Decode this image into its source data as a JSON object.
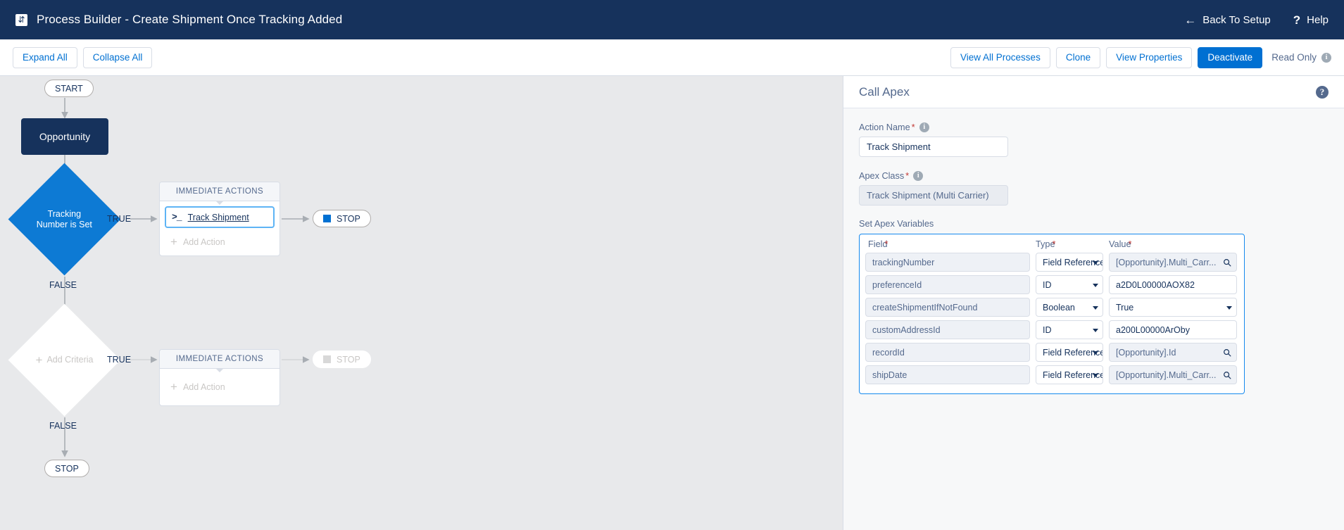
{
  "topbar": {
    "app_icon": "process-builder-icon",
    "title": "Process Builder - Create Shipment Once Tracking Added",
    "back_label": "Back To Setup",
    "help_label": "Help",
    "bg_color": "#16325c"
  },
  "toolbar": {
    "expand_all": "Expand All",
    "collapse_all": "Collapse All",
    "view_all_processes": "View All Processes",
    "clone": "Clone",
    "view_properties": "View Properties",
    "deactivate": "Deactivate",
    "read_only": "Read Only",
    "primary_color": "#0070d2"
  },
  "canvas": {
    "start_label": "START",
    "object_node": "Opportunity",
    "criteria_1": "Tracking\nNumber is Set",
    "criteria_1_line1": "Tracking",
    "criteria_1_line2": "Number is Set",
    "criteria_2": "Add Criteria",
    "true_label_1": "TRUE",
    "false_label_1": "FALSE",
    "true_label_2": "TRUE",
    "false_label_2": "FALSE",
    "immediate_actions_1": "IMMEDIATE ACTIONS",
    "immediate_actions_2": "IMMEDIATE ACTIONS",
    "action_1": "Track Shipment",
    "action_1_icon": "apex-code-icon",
    "add_action_1": "Add Action",
    "add_action_2": "Add Action",
    "stop_1": "STOP",
    "stop_2": "STOP",
    "stop_3": "STOP",
    "accent_blue": "#0d7ad4",
    "node_navy": "#16325c"
  },
  "panel": {
    "title": "Call Apex",
    "help_icon": "help-icon",
    "action_name_label": "Action Name",
    "action_name_value": "Track Shipment",
    "apex_class_label": "Apex Class",
    "apex_class_value": "Track Shipment (Multi Carrier)",
    "set_apex_variables_label": "Set Apex Variables",
    "columns": [
      "Field",
      "Type",
      "Value"
    ],
    "rows": [
      {
        "field": "trackingNumber",
        "type": "Field Reference",
        "value": "[Opportunity].Multi_Carr...",
        "value_icon": "search-icon",
        "field_readonly": true,
        "value_readonly": true,
        "type_select": true
      },
      {
        "field": "preferenceId",
        "type": "ID",
        "value": "a2D0L00000AOX82",
        "value_icon": "",
        "field_readonly": true,
        "value_readonly": false,
        "type_select": true
      },
      {
        "field": "createShipmentIfNotFound",
        "type": "Boolean",
        "value": "True",
        "value_icon": "caret-down-icon",
        "field_readonly": true,
        "value_readonly": false,
        "type_select": true
      },
      {
        "field": "customAddressId",
        "type": "ID",
        "value": "a200L00000ArOby",
        "value_icon": "",
        "field_readonly": true,
        "value_readonly": false,
        "type_select": true
      },
      {
        "field": "recordId",
        "type": "Field Reference",
        "value": "[Opportunity].Id",
        "value_icon": "search-icon",
        "field_readonly": true,
        "value_readonly": true,
        "type_select": true
      },
      {
        "field": "shipDate",
        "type": "Field Reference",
        "value": "[Opportunity].Multi_Carr...",
        "value_icon": "search-icon",
        "field_readonly": true,
        "value_readonly": true,
        "type_select": true
      }
    ],
    "border_accent": "#1589ee"
  }
}
